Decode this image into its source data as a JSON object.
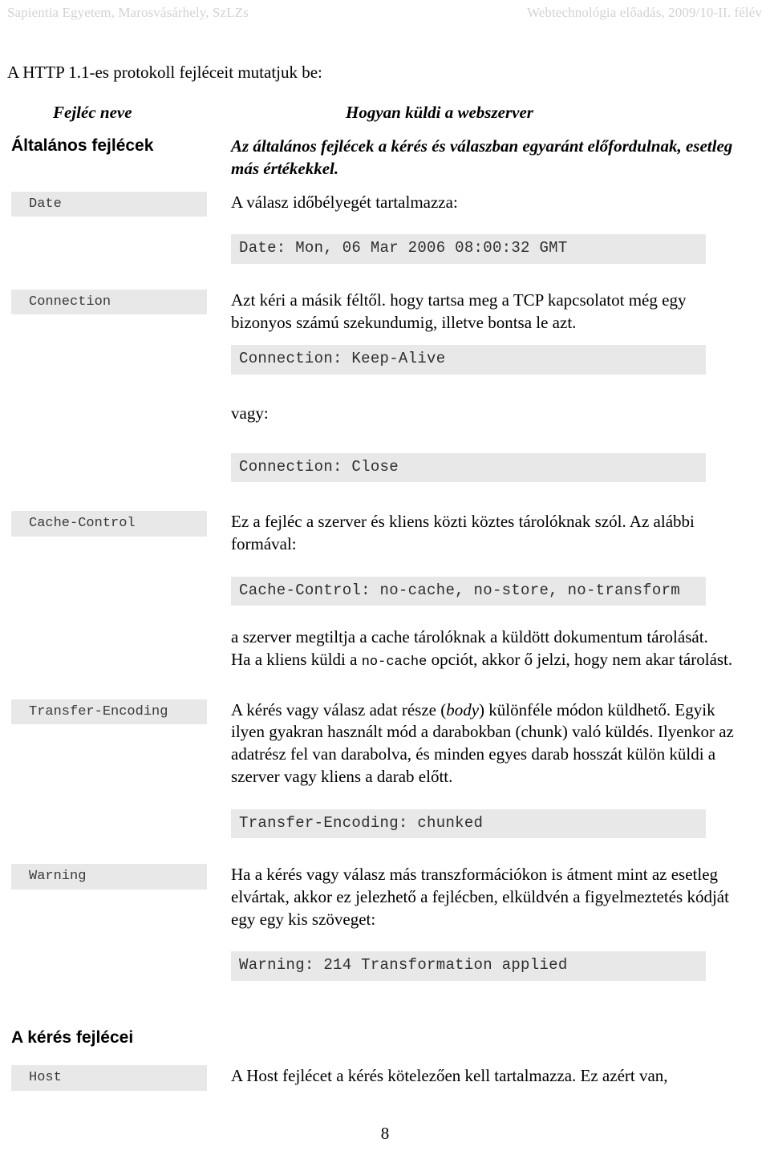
{
  "running_header": {
    "left": "Sapientia Egyetem, Marosvásárhely, SzLZs",
    "right": "Webtechnológia előadás, 2009/10-II. félév"
  },
  "intro_line": "A  HTTP 1.1-es protokoll fejléceit mutatjuk be:",
  "table_headings": {
    "left": "Fejléc neve",
    "right": "Hogyan küldi a webszerver"
  },
  "sections": {
    "general_headers_label": "Általános fejlécek",
    "general_headers_desc": "Az általános fejlécek a kérés és válaszban egyaránt előfordulnak, esetleg más értékekkel.",
    "request_headers_label": "A kérés fejlécei"
  },
  "rows": {
    "date": {
      "name": "Date",
      "desc": "A válasz időbélyegét tartalmazza:",
      "code": "Date: Mon, 06 Mar 2006 08:00:32 GMT"
    },
    "connection": {
      "name": "Connection",
      "desc": "Azt kéri a másik féltől. hogy tartsa meg a TCP kapcsolatot még egy bizonyos számú szekundumig, illetve bontsa le azt.",
      "code1": "Connection: Keep-Alive",
      "or_label": "vagy:",
      "code2": "Connection: Close"
    },
    "cache_control": {
      "name": "Cache-Control",
      "desc": "Ez a fejléc a szerver és kliens közti köztes tárolóknak szól. Az alábbi formával:",
      "code": "Cache-Control: no-cache, no-store, no-transform",
      "note_part1": "a szerver megtiltja a cache tárolóknak a küldött dokumentum tárolását.",
      "note_part2_a": "Ha a kliens küldi a ",
      "note_part2_mono": "no-cache",
      "note_part2_b": " opciót, akkor ő jelzi, hogy nem akar tárolást."
    },
    "transfer_encoding": {
      "name": "Transfer-Encoding",
      "desc_a": "A kérés vagy válasz adat része (",
      "desc_em": "body",
      "desc_b": ") különféle módon küldhető. Egyik ilyen gyakran használt mód a darabokban (chunk) való küldés. Ilyenkor az adatrész fel van darabolva, és minden egyes darab hosszát külön küldi a szerver vagy kliens a darab előtt.",
      "code": "Transfer-Encoding: chunked"
    },
    "warning": {
      "name": "Warning",
      "desc": "Ha a kérés vagy válasz más transzformációkon is átment mint az esetleg elvártak, akkor ez jelezhető a fejlécben, elküldvén a figyelmeztetés kódját egy egy kis szöveget:",
      "code": "Warning: 214 Transformation applied"
    },
    "host": {
      "name": "Host",
      "desc": "A Host fejlécet a kérés kötelezően kell tartalmazza. Ez azért van,"
    }
  },
  "page_number": "8",
  "colors": {
    "header_gray": "#d2d2d2",
    "code_background": "#e8e8e8",
    "chip_text": "#3a3a3a"
  }
}
